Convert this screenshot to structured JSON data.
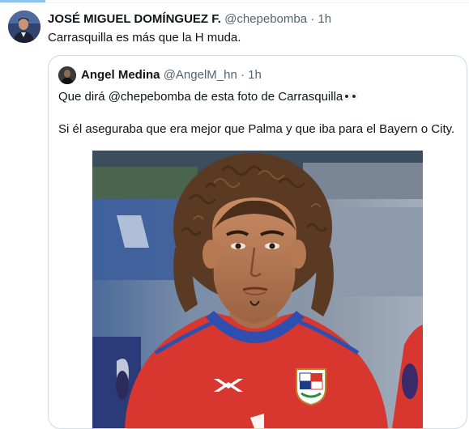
{
  "outer_tweet": {
    "author_name": "JOSÉ MIGUEL DOMÍNGUEZ F.",
    "author_handle": "@chepebomba",
    "separator": "·",
    "time": "1h",
    "text": "Carrasquilla es más que la H muda."
  },
  "quoted_tweet": {
    "author_name": "Angel Medina",
    "author_handle": "@AngelM_hn",
    "separator": "·",
    "time": "1h",
    "text_line1": "Que dirá @chepebomba de esta foto de Carrasquilla",
    "emoji": "eyes-emoji",
    "text_line2": "Si él aseguraba que era mejor que Palma y que iba para el Bayern o City."
  },
  "colors": {
    "text_primary": "#0f1419",
    "text_muted": "#536471",
    "border": "#cfd9de",
    "jersey_red": "#d8372f",
    "jersey_blue": "#2e4fb0"
  },
  "icons": {
    "outer_avatar": "profile-photo",
    "quoted_avatar": "profile-photo",
    "jersey_crest": "panama-crest",
    "jersey_brand": "umbro-logo"
  }
}
